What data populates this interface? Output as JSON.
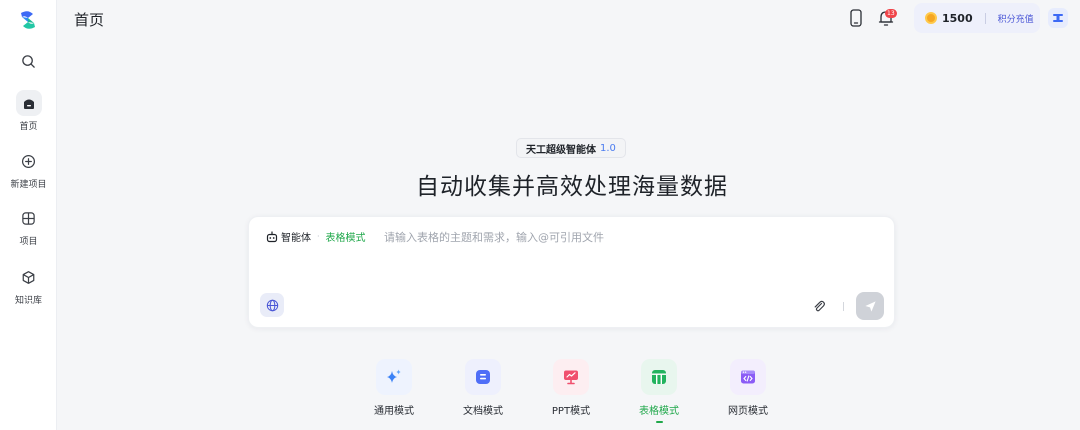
{
  "sidebar": {
    "items": [
      {
        "label": "首页"
      },
      {
        "label": "新建项目"
      },
      {
        "label": "项目"
      },
      {
        "label": "知识库"
      }
    ]
  },
  "header": {
    "title": "首页",
    "notification_count": "13",
    "credits": "1500",
    "recharge_label": "积分充值"
  },
  "hero": {
    "agent_name": "天工超级智能体",
    "version": "1.0",
    "headline": "自动收集并高效处理海量数据"
  },
  "input": {
    "agent_label": "智能体",
    "mode_label": "表格模式",
    "placeholder": "请输入表格的主题和需求，输入@可引用文件"
  },
  "modes": [
    {
      "label": "通用模式",
      "icon": "sparkle-icon",
      "color": "#3b82f6"
    },
    {
      "label": "文档模式",
      "icon": "document-icon",
      "color": "#4f6ef7"
    },
    {
      "label": "PPT模式",
      "icon": "presentation-icon",
      "color": "#f0506e"
    },
    {
      "label": "表格模式",
      "icon": "table-icon",
      "color": "#22b35e",
      "active": true
    },
    {
      "label": "网页模式",
      "icon": "webpage-icon",
      "color": "#8b5cf6"
    }
  ],
  "colors": {
    "accent_green": "#20a84b",
    "accent_blue": "#4b7cf0",
    "badge_red": "#f0454a"
  }
}
